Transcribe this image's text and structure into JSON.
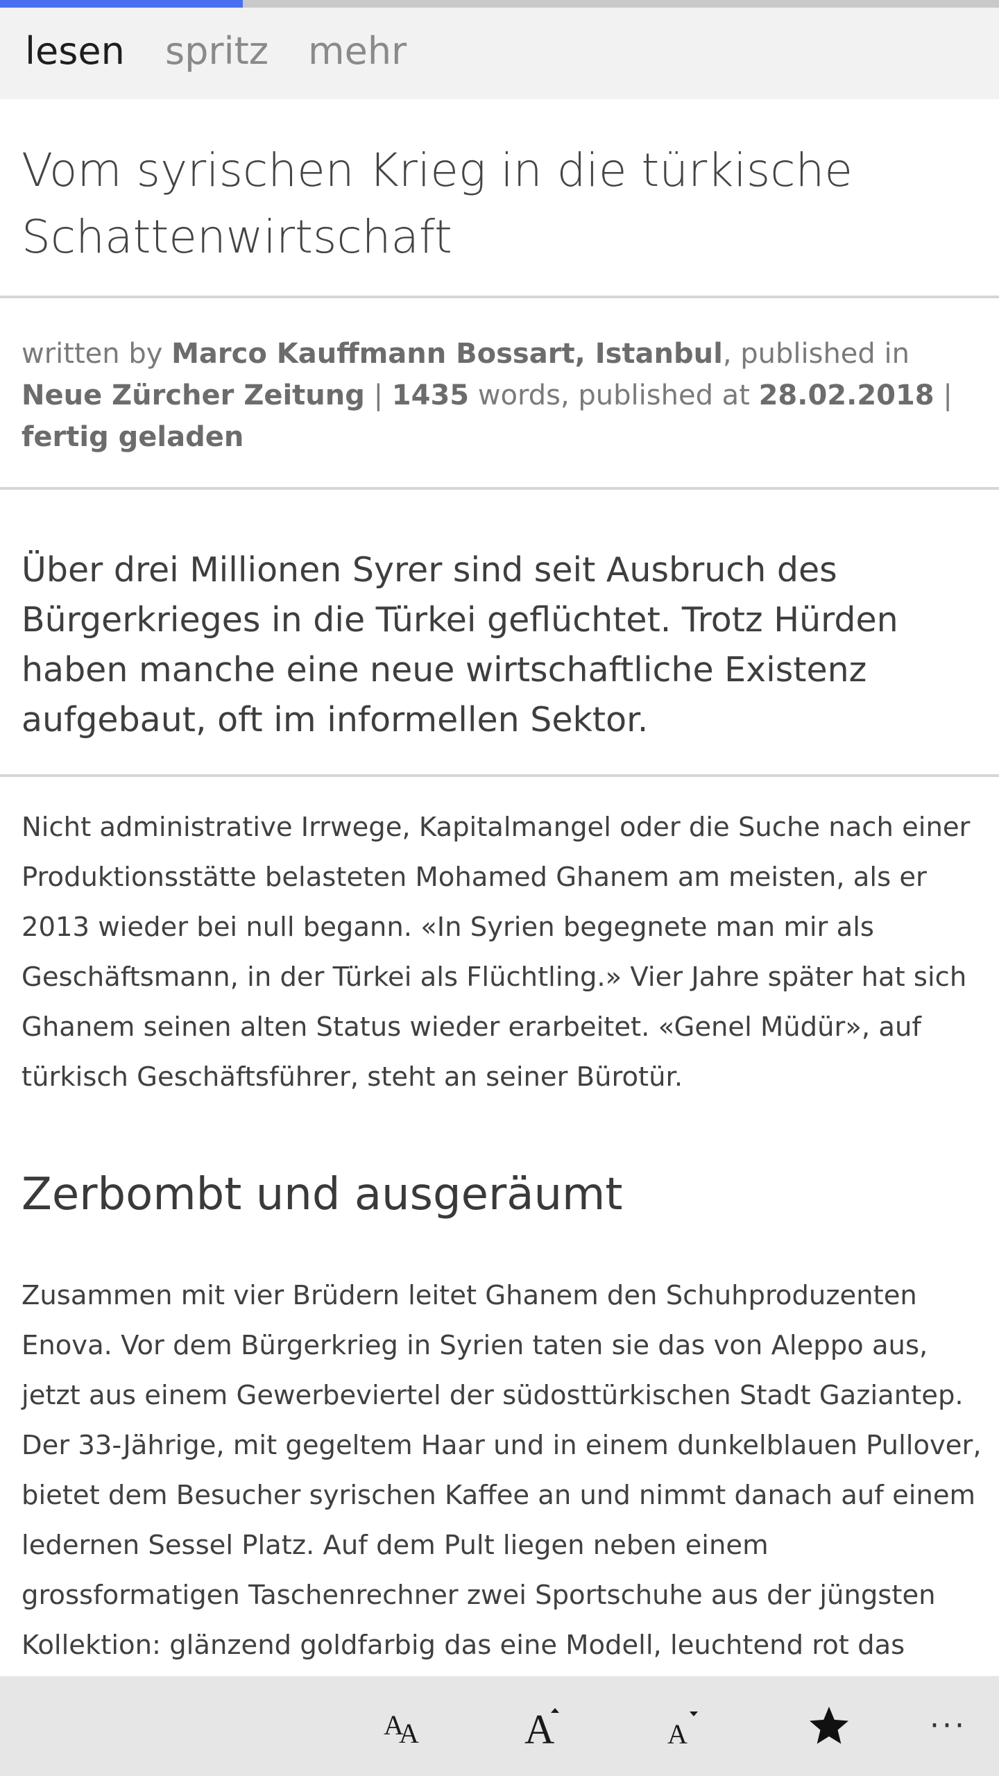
{
  "progress": {
    "fraction": 0.243
  },
  "tabs": [
    {
      "label": "lesen",
      "active": true
    },
    {
      "label": "spritz",
      "active": false
    },
    {
      "label": "mehr",
      "active": false
    }
  ],
  "article": {
    "title": "Vom syrischen Krieg in die türkische Schattenwirtschaft",
    "meta": {
      "written_by_label": "written by ",
      "author": "Marco Kauffmann Bossart, Istanbul",
      "published_in_label": ", published in ",
      "publication": "Neue Zürcher Zeitung",
      "sep1": " | ",
      "word_count": "1435",
      "words_label": " words, published at ",
      "date": "28.02.2018",
      "sep2": " | ",
      "status": "fertig geladen"
    },
    "lead": "Über drei Millionen Syrer sind seit Ausbruch des Bürgerkrieges in die Türkei geflüchtet. Trotz Hürden haben manche eine neue wirtschaftliche Existenz aufgebaut, oft im informellen Sektor.",
    "paragraph1": "Nicht administrative Irrwege, Kapitalmangel oder die Suche nach einer Produktionsstätte belasteten Mohamed Ghanem am meisten, als er 2013 wieder bei null begann. «In Syrien begegnete man mir als Geschäftsmann, in der Türkei als Flüchtling.» Vier Jahre später hat sich Ghanem seinen alten Status wieder erarbeitet. «Genel Müdür», auf türkisch Geschäftsführer, steht an seiner Bürotür.",
    "subheading": "Zerbombt und ausgeräumt",
    "paragraph2": "Zusammen mit vier Brüdern leitet Ghanem den Schuhproduzenten Enova. Vor dem Bürgerkrieg in Syrien taten sie das von Aleppo aus, jetzt aus einem Gewerbeviertel der südosttürkischen Stadt Gaziantep. Der 33-Jährige, mit gegeltem Haar und in einem dunkelblauen Pullover, bietet dem Besucher syrischen Kaffee an und nimmt danach auf einem ledernen Sessel Platz. Auf dem Pult liegen neben einem grossformatigen Taschenrechner zwei Sportschuhe aus der jüngsten Kollektion: glänzend goldfarbig das eine Modell, leuchtend rot das"
  },
  "appbar": {
    "icons": [
      "font-style-icon",
      "increase-font-icon",
      "decrease-font-icon",
      "star-icon",
      "more-icon"
    ],
    "more_label": "···"
  },
  "colors": {
    "progress": "#4a6ef0",
    "track": "#c9c9c9",
    "appbar": "#e6e6e6",
    "tabbar": "#f2f2f2"
  }
}
